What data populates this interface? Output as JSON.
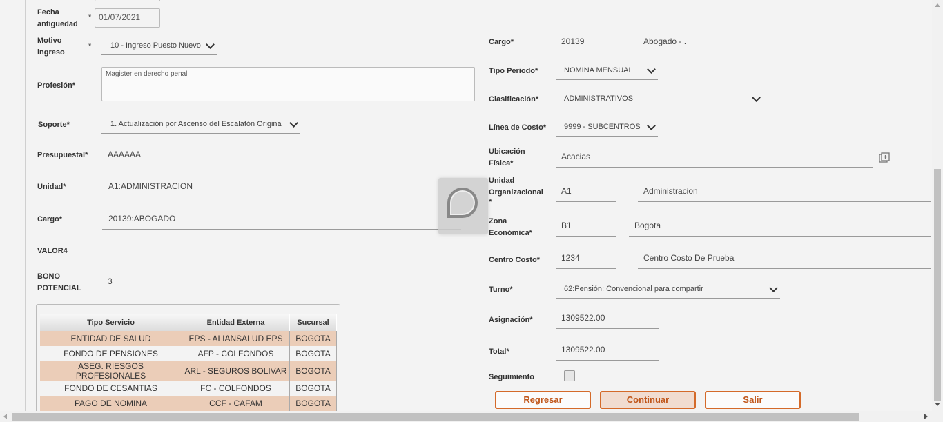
{
  "left": {
    "fecha_antiguedad": {
      "label_1": "Fecha",
      "label_2": "antiguedad",
      "value": "01/07/2021"
    },
    "motivo_ingreso": {
      "label_1": "Motivo",
      "label_2": "ingreso",
      "value": "10 - Ingreso Puesto Nuevo"
    },
    "profesion": {
      "label": "Profesión",
      "value": "Magister en derecho penal"
    },
    "soporte": {
      "label": "Soporte",
      "value": "1. Actualización por Ascenso del Escalafón Origina"
    },
    "presupuestal": {
      "label": "Presupuestal",
      "value": "AAAAAA"
    },
    "unidad": {
      "label": "Unidad",
      "value": "A1:ADMINISTRACION"
    },
    "cargo": {
      "label": "Cargo",
      "value": "20139:ABOGADO"
    },
    "valor4": {
      "label": "VALOR4",
      "value": ""
    },
    "bono_potencial": {
      "label_1": "BONO",
      "label_2": "POTENCIAL",
      "value": "3"
    },
    "required_mark": "*"
  },
  "services_table": {
    "headers": [
      "Tipo Servicio",
      "Entidad Externa",
      "Sucursal"
    ],
    "rows": [
      [
        "ENTIDAD DE SALUD",
        "EPS - ALIANSALUD EPS",
        "BOGOTA"
      ],
      [
        "FONDO DE PENSIONES",
        "AFP - COLFONDOS",
        "BOGOTA"
      ],
      [
        "ASEG. RIESGOS PROFESIONALES",
        "ARL - SEGUROS BOLIVAR",
        "BOGOTA"
      ],
      [
        "FONDO DE CESANTIAS",
        "FC - COLFONDOS",
        "BOGOTA"
      ],
      [
        "PAGO DE NOMINA",
        "CCF - CAFAM",
        "BOGOTA"
      ]
    ]
  },
  "right": {
    "cargo": {
      "label": "Cargo*",
      "code": "20139",
      "desc": "Abogado - ."
    },
    "tipo_periodo": {
      "label": "Tipo Periodo*",
      "value": "NOMINA MENSUAL"
    },
    "clasificacion": {
      "label": "Clasificación*",
      "value": "ADMINISTRATIVOS"
    },
    "linea_costo": {
      "label": "Línea de Costo*",
      "value": "9999 - SUBCENTROS"
    },
    "ubicacion_fisica": {
      "label_1": "Ubicación",
      "label_2": "Física*",
      "value": "Acacias"
    },
    "unidad_organizacional": {
      "label_1": "Unidad",
      "label_2": "Organizacional",
      "label_3": "*",
      "code": "A1",
      "desc": "Administracion"
    },
    "zona_economica": {
      "label_1": "Zona",
      "label_2": "Económica*",
      "code": "B1",
      "desc": "Bogota"
    },
    "centro_costo": {
      "label": "Centro Costo*",
      "code": "1234",
      "desc": "Centro Costo De Prueba"
    },
    "turno": {
      "label": "Turno*",
      "value": "62:Pensión: Convencional para compartir"
    },
    "asignacion": {
      "label": "Asignación*",
      "value": "1309522.00"
    },
    "total": {
      "label": "Total*",
      "value": "1309522.00"
    },
    "seguimiento": {
      "label": "Seguimiento",
      "checked": false
    }
  },
  "buttons": {
    "regresar": "Regresar",
    "continuar": "Continuar",
    "salir": "Salir"
  },
  "colors": {
    "accent": "#d46a2a",
    "row_highlight": "#ebcdb8"
  }
}
